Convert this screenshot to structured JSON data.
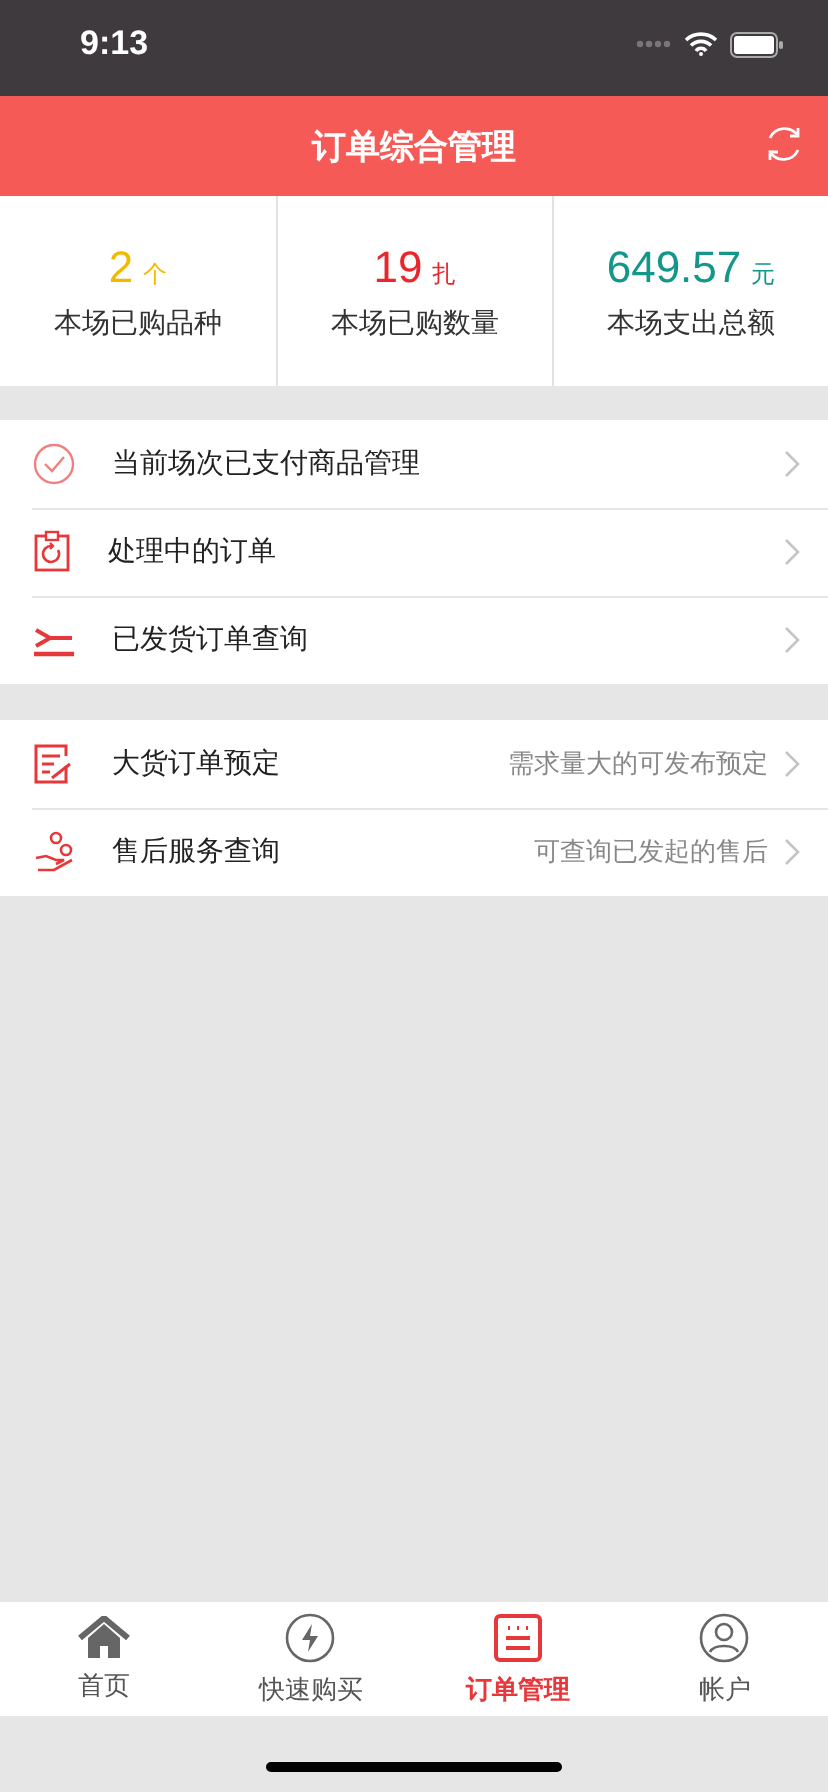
{
  "status_bar": {
    "time": "9:13"
  },
  "header": {
    "title": "订单综合管理"
  },
  "stats": [
    {
      "value": "2",
      "unit": "个",
      "label": "本场已购品种",
      "color": "#f5b800"
    },
    {
      "value": "19",
      "unit": "扎",
      "label": "本场已购数量",
      "color": "#e8262b"
    },
    {
      "value": "649.57",
      "unit": "元",
      "label": "本场支出总额",
      "color": "#14968a"
    }
  ],
  "menu_groups": [
    [
      {
        "label": "当前场次已支付商品管理"
      },
      {
        "label": "处理中的订单"
      },
      {
        "label": "已发货订单查询"
      }
    ],
    [
      {
        "label": "大货订单预定",
        "hint": "需求量大的可发布预定"
      },
      {
        "label": "售后服务查询",
        "hint": "可查询已发起的售后"
      }
    ]
  ],
  "tab_bar": [
    {
      "label": "首页",
      "selected": false
    },
    {
      "label": "快速购买",
      "selected": false
    },
    {
      "label": "订单管理",
      "selected": true
    },
    {
      "label": "帐户",
      "selected": false
    }
  ]
}
